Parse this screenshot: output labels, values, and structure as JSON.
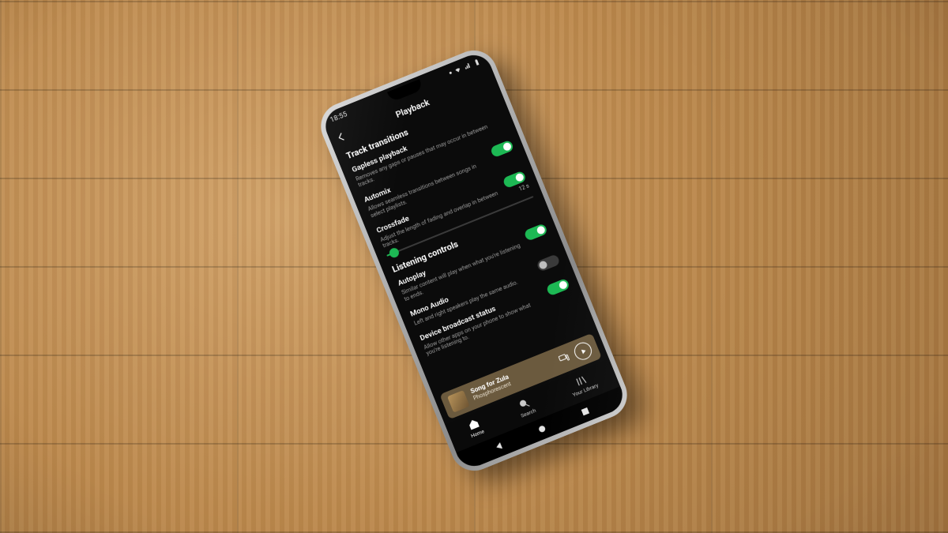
{
  "status_bar": {
    "time": "18:55"
  },
  "header": {
    "title": "Playback"
  },
  "sections": {
    "transitions": {
      "title": "Track transitions",
      "gapless": {
        "label": "Gapless playback",
        "desc": "Removes any gaps or pauses that may occur in between tracks.",
        "toggle": true
      },
      "automix": {
        "label": "Automix",
        "desc": "Allows seamless transitions between songs in select playlists.",
        "toggle": true
      },
      "crossfade": {
        "label": "Crossfade",
        "desc": "Adjust the length of fading and overlap in between tracks.",
        "seconds_label": "12 s",
        "slider_percent": 5
      }
    },
    "listening": {
      "title": "Listening controls",
      "autoplay": {
        "label": "Autoplay",
        "desc": "Similar content will play when what you're listening to ends.",
        "toggle": true
      },
      "mono": {
        "label": "Mono Audio",
        "desc": "Left and right speakers play the same audio.",
        "toggle": false
      },
      "broadcast": {
        "label": "Device broadcast status",
        "desc": "Allow other apps on your phone to show what you're listening to.",
        "toggle": true
      }
    }
  },
  "now_playing": {
    "title": "Song for Zula",
    "artist": "Phosphorescent"
  },
  "nav": {
    "home": "Home",
    "search": "Search",
    "library": "Your Library"
  },
  "colors": {
    "accent": "#1db954",
    "now_playing_bg": "#6b5a3e"
  }
}
